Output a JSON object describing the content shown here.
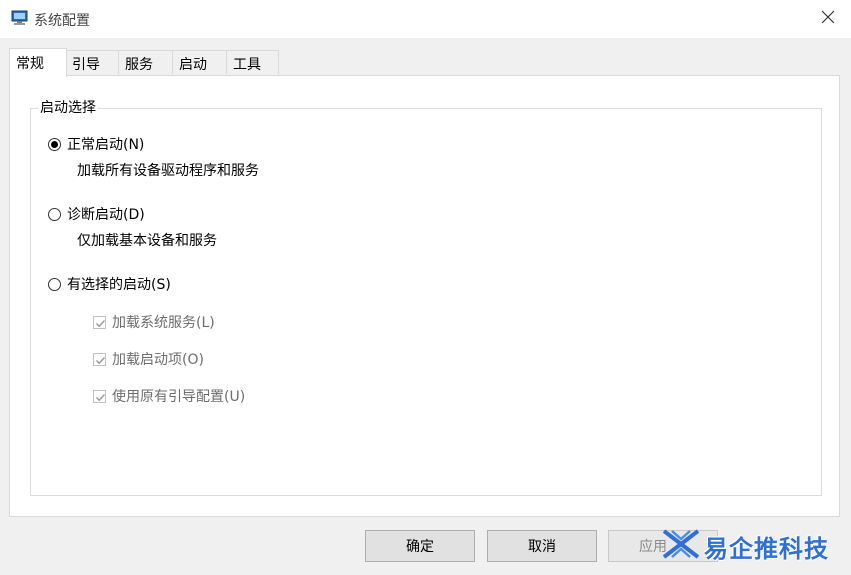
{
  "window": {
    "title": "系统配置"
  },
  "tabs": [
    {
      "label": "常规",
      "active": true
    },
    {
      "label": "引导"
    },
    {
      "label": "服务"
    },
    {
      "label": "启动"
    },
    {
      "label": "工具"
    }
  ],
  "startup_selection": {
    "legend": "启动选择",
    "normal": {
      "label": "正常启动(N)",
      "desc": "加载所有设备驱动程序和服务",
      "checked": true
    },
    "diagnostic": {
      "label": "诊断启动(D)",
      "desc": "仅加载基本设备和服务",
      "checked": false
    },
    "selective": {
      "label": "有选择的启动(S)",
      "checked": false,
      "options": [
        {
          "label": "加载系统服务(L)",
          "checked": true,
          "disabled": true
        },
        {
          "label": "加载启动项(O)",
          "checked": true,
          "disabled": true
        },
        {
          "label": "使用原有引导配置(U)",
          "checked": true,
          "disabled": true
        }
      ]
    }
  },
  "buttons": {
    "ok": "确定",
    "cancel": "取消",
    "apply": "应用"
  },
  "watermark": {
    "text": "易企推科技"
  },
  "icons": {
    "app": "msconfig-app-icon",
    "close": "close-icon",
    "watermark": "watermark-logo-icon"
  },
  "colors": {
    "accent": "#2f6fd6",
    "window_bg": "#f0f0f0",
    "panel_bg": "#ffffff"
  }
}
